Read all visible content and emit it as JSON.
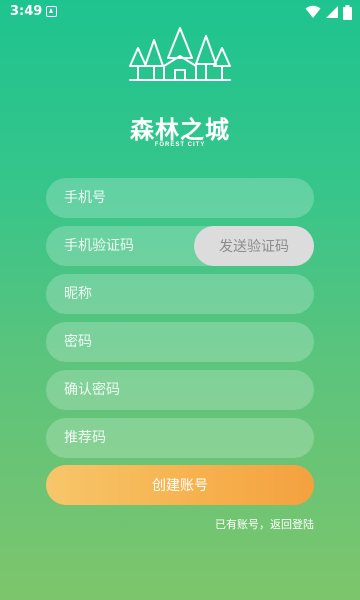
{
  "status_bar": {
    "time": "3:49",
    "icons": [
      "notification-icon",
      "wifi-icon",
      "signal-icon",
      "battery-icon"
    ]
  },
  "brand": {
    "title": "森林之城",
    "subtitle": "FOREST CITY",
    "logo_icon": "forest-city-logo-icon"
  },
  "form": {
    "phone_placeholder": "手机号",
    "code_placeholder": "手机验证码",
    "send_code_label": "发送验证码",
    "nickname_placeholder": "昵称",
    "password_placeholder": "密码",
    "confirm_password_placeholder": "确认密码",
    "referral_placeholder": "推荐码",
    "submit_label": "创建账号"
  },
  "footer": {
    "back_to_login": "已有账号，返回登陆"
  },
  "colors": {
    "background_top": "#1ec48f",
    "background_bottom": "#7dc56c",
    "submit_gradient_start": "#f7c66a",
    "submit_gradient_end": "#f4a13f",
    "send_code_bg": "#dcdcdc",
    "send_code_text": "#8c8c8c"
  }
}
